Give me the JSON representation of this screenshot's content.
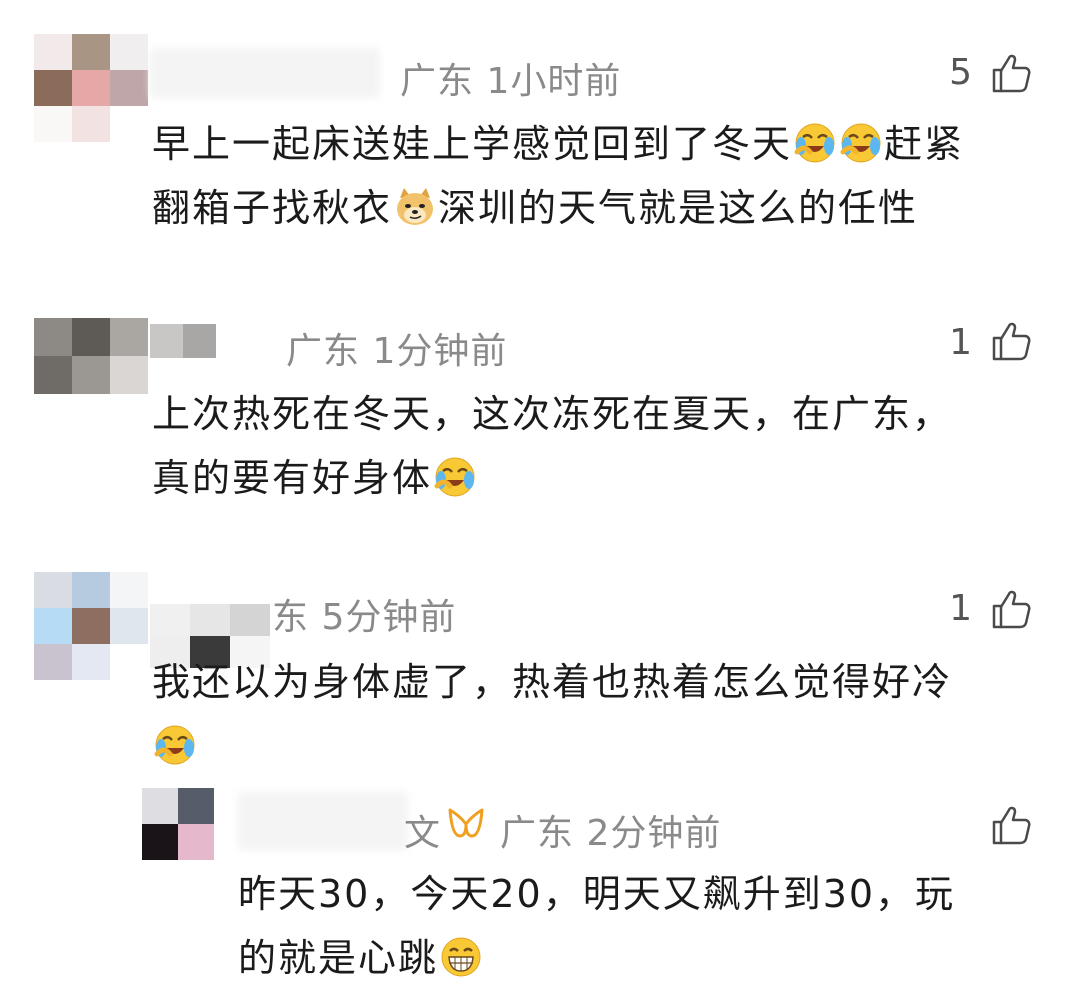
{
  "comments": [
    {
      "location": "广东",
      "time": "1小时前",
      "likes": "5",
      "line1": "早上一起床送娃上学感觉回到了冬天",
      "line1_tail": "赶紧",
      "line2_a": "翻箱子找秋衣",
      "line2_b": "深圳的天气就是这么的任性"
    },
    {
      "location": "广东",
      "time": "1分钟前",
      "likes": "1",
      "line1": "上次热死在冬天，这次冻死在夏天，在广东，",
      "line2": "真的要有好身体"
    },
    {
      "location": "东",
      "time": "5分钟前",
      "likes": "1",
      "line1": "我还以为身体虚了，热着也热着怎么觉得好冷"
    }
  ],
  "reply": {
    "name_fragment": "文",
    "location": "广东",
    "time": "2分钟前",
    "line1": "昨天30，今天20，明天又飙升到30，玩",
    "line2": "的就是心跳"
  },
  "icons": {
    "like": "thumbs-up-icon",
    "cry": "crying-laughing-emoji",
    "doge": "doge-emoji",
    "grin": "grinning-emoji",
    "badge": "gold-badge-icon"
  }
}
